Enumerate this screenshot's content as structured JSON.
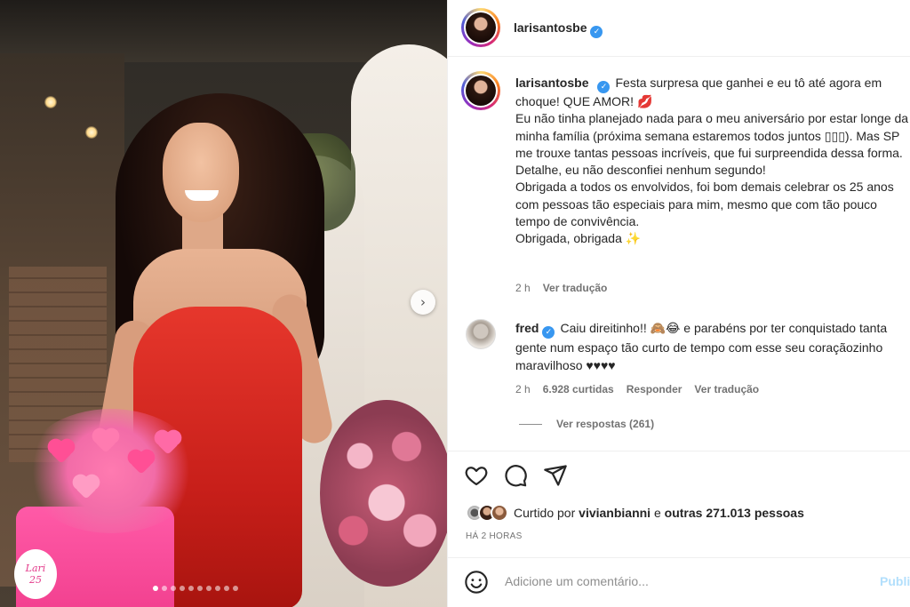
{
  "post": {
    "username": "larisantosbe",
    "verified_icon": "verified-badge-icon",
    "carousel": {
      "slide_count": 10,
      "active_index": 0
    },
    "cake_tag": "Lari\n25",
    "caption": {
      "username": "larisantosbe",
      "text": "Festa surpresa que ganhei e eu tô até agora em choque! QUE AMOR! 💋\nEu não tinha planejado nada para o meu aniversário por estar longe da minha família (próxima semana estaremos todos juntos ▯▯▯). Mas SP me trouxe tantas pessoas incríveis, que fui surpreendida dessa forma. Detalhe, eu não desconfiei nenhum segundo!\nObrigada a todos os envolvidos, foi bom demais celebrar os 25 anos com pessoas tão especiais para mim, mesmo que com tão pouco tempo de convivência.\nObrigada, obrigada ✨",
      "time": "2 h",
      "see_translation": "Ver tradução"
    },
    "comment": {
      "username": "fred",
      "text": "Caiu direitinho!! 🙈😂 e parabéns por ter conquistado tanta gente num espaço tão curto de tempo com esse seu coraçãozinho maravilhoso ♥♥♥♥",
      "time": "2 h",
      "likes": "6.928 curtidas",
      "reply": "Responder",
      "see_translation": "Ver tradução",
      "view_replies": "Ver respostas (261)"
    },
    "actions": {
      "like_icon": "heart-icon",
      "comment_icon": "comment-icon",
      "share_icon": "share-icon"
    },
    "likes_line": {
      "prefix": "Curtido por ",
      "user": "vivianbianni",
      "middle": " e ",
      "others": "outras 271.013 pessoas"
    },
    "timestamp": "HÁ 2 HORAS",
    "add_comment": {
      "emoji_icon": "emoji-icon",
      "placeholder": "Adicione um comentário...",
      "publish": "Publi"
    }
  },
  "colors": {
    "accent": "#3897f0",
    "muted": "#737373",
    "publish_disabled": "#b2dffc",
    "dress": "#d92a22"
  }
}
